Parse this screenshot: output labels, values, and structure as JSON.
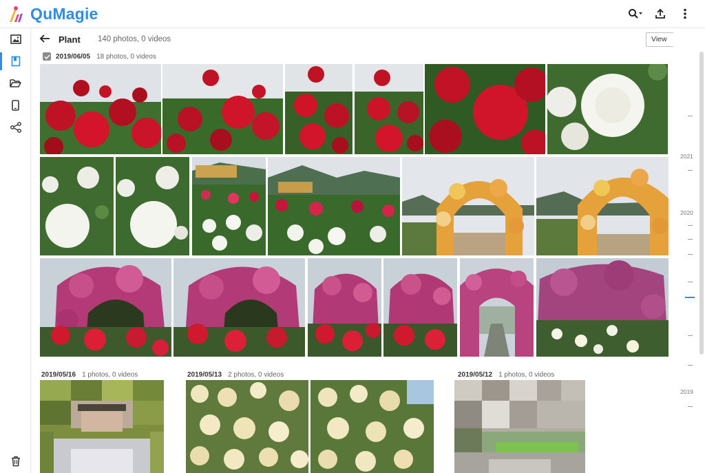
{
  "app": {
    "name": "QuMagie",
    "brand_color": "#2f8de4"
  },
  "topbar": {
    "icons": [
      "search-icon",
      "upload-icon",
      "more-icon"
    ]
  },
  "sidebar": {
    "items": [
      {
        "name": "photos-icon",
        "active": false
      },
      {
        "name": "albums-icon",
        "active": true
      },
      {
        "name": "folders-icon",
        "active": false
      },
      {
        "name": "mobile-icon",
        "active": false
      },
      {
        "name": "share-icon",
        "active": false
      },
      {
        "name": "trash-icon",
        "active": false
      }
    ]
  },
  "album": {
    "title": "Plant",
    "count": "140 photos, 0 videos",
    "view_label": "View"
  },
  "groups": [
    {
      "date": "2019/06/05",
      "count": "18 photos, 0 videos"
    },
    {
      "date": "2019/05/16",
      "count": "1 photos, 0 videos"
    },
    {
      "date": "2019/05/13",
      "count": "2 photos, 0 videos"
    },
    {
      "date": "2019/05/12",
      "count": "1 photos, 0 videos"
    }
  ],
  "timeline": {
    "years": [
      "2021",
      "2020",
      "2019"
    ]
  }
}
